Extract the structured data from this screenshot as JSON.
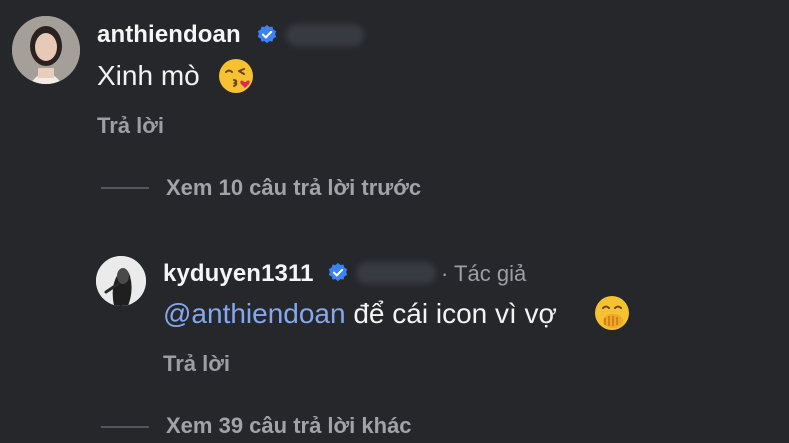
{
  "comments": [
    {
      "username": "anthiendoan",
      "text": "Xinh mò",
      "emoji": "kissing-face-with-heart-emoji",
      "reply_label": "Trả lời"
    },
    {
      "username": "kyduyen1311",
      "author_tag": "Tác giả",
      "mention": "@anthiendoan",
      "text": "để cái icon vì vợ",
      "emoji": "face-with-hand-over-mouth-emoji",
      "reply_label": "Trả lời"
    }
  ],
  "view_previous_replies": "Xem 10 câu trả lời trước",
  "view_more_replies": "Xem 39 câu trả lời khác",
  "colors": {
    "background": "#26272b",
    "mention": "#84a8f0",
    "verified": "#3b82f6",
    "secondary_text": "#9d9ea4"
  }
}
